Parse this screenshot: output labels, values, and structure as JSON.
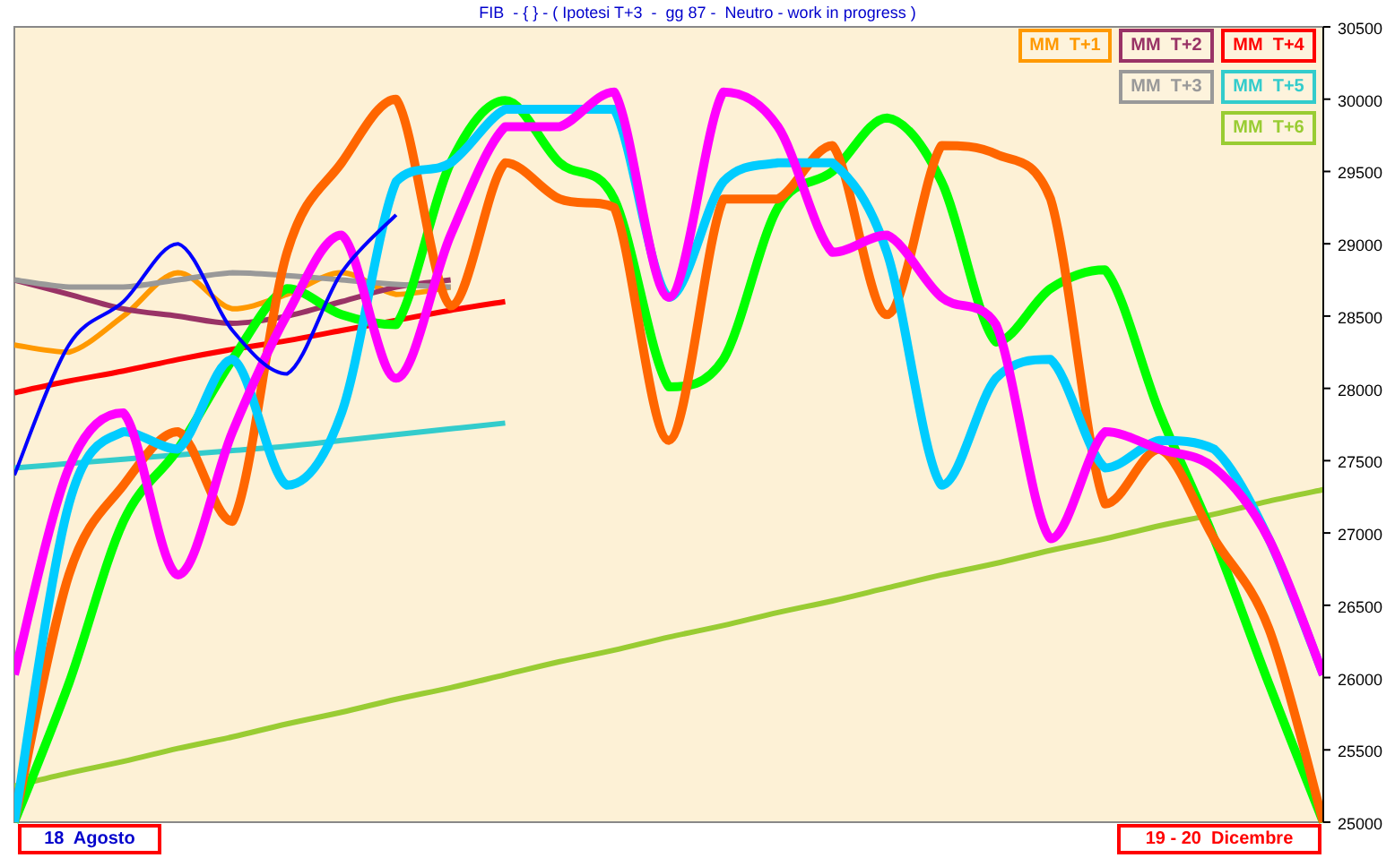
{
  "chart": {
    "title": "FIB  - { } - ( Ipotesi T+3  -  gg 87 -  Neutro - work in progress )",
    "start_label": "18  Agosto",
    "end_label": "19 - 20  Dicembre",
    "chart_data": {
      "type": "line",
      "ylim": [
        25000,
        30500
      ],
      "yticks": [
        25000,
        25500,
        26000,
        26500,
        27000,
        27500,
        28000,
        28500,
        29000,
        29500,
        30000,
        30500
      ],
      "series": [
        {
          "name": "MM  T+1",
          "color": "#ff9900",
          "values": [
            28300,
            28250,
            28500,
            28800,
            28550,
            28650,
            28800,
            28650,
            28700,
            null,
            null,
            null,
            null,
            null,
            null,
            null,
            null,
            null,
            null,
            null,
            null,
            null,
            null,
            null,
            null
          ]
        },
        {
          "name": "MM  T+2",
          "color": "#993366",
          "values": [
            28750,
            28650,
            28550,
            28500,
            28450,
            28500,
            28600,
            28700,
            28750,
            null,
            null,
            null,
            null,
            null,
            null,
            null,
            null,
            null,
            null,
            null,
            null,
            null,
            null,
            null,
            null
          ]
        },
        {
          "name": "MM  T+4",
          "color": "#ff0000",
          "values": [
            27970,
            28050,
            28120,
            28200,
            28270,
            28330,
            28400,
            28470,
            28540,
            28600,
            null,
            null,
            null,
            null,
            null,
            null,
            null,
            null,
            null,
            null,
            null,
            null,
            null,
            null,
            null
          ]
        },
        {
          "name": "MM  T+3",
          "color": "#999999",
          "values": [
            28750,
            28700,
            28700,
            28750,
            28800,
            28780,
            28750,
            28720,
            28700,
            null,
            null,
            null,
            null,
            null,
            null,
            null,
            null,
            null,
            null,
            null,
            null,
            null,
            null,
            null,
            null
          ]
        },
        {
          "name": "MM  T+5",
          "color": "#33cccc",
          "values": [
            27450,
            27480,
            27510,
            27540,
            27570,
            27600,
            27640,
            27680,
            27720,
            27760,
            null,
            null,
            null,
            null,
            null,
            null,
            null,
            null,
            null,
            null,
            null,
            null,
            null,
            null,
            null
          ]
        },
        {
          "name": "MM  T+6",
          "color": "#99cc33",
          "values": [
            25250,
            25340,
            25420,
            25510,
            25590,
            25680,
            25760,
            25850,
            25930,
            26020,
            26110,
            26190,
            26280,
            26360,
            26450,
            26530,
            26620,
            26710,
            26790,
            26880,
            26960,
            27050,
            27130,
            27220,
            27300
          ]
        },
        {
          "color": "#00ff00",
          "values": [
            25000,
            25960,
            27080,
            27580,
            28200,
            28690,
            28510,
            28440,
            29560,
            29990,
            29560,
            29310,
            28010,
            28200,
            29250,
            29500,
            29870,
            29430,
            28320,
            28690,
            28820,
            27830,
            26960,
            25960,
            25000
          ]
        },
        {
          "color": "#ff6600",
          "values": [
            25000,
            26710,
            27330,
            27700,
            27080,
            28940,
            29560,
            30000,
            28570,
            29560,
            29310,
            29250,
            27640,
            29310,
            29310,
            29680,
            28510,
            29680,
            29620,
            29310,
            27200,
            27580,
            26960,
            26340,
            25000
          ]
        },
        {
          "color": "#00ccff",
          "values": [
            25000,
            27200,
            27700,
            27580,
            28200,
            27330,
            27830,
            29430,
            29560,
            29930,
            29930,
            29930,
            28630,
            29430,
            29560,
            29560,
            28940,
            27330,
            28070,
            28200,
            27450,
            27640,
            27580,
            26960,
            26020
          ]
        },
        {
          "color": "#ff00ff",
          "values": [
            26020,
            27450,
            27830,
            26710,
            27700,
            28510,
            29060,
            28070,
            29060,
            29810,
            29810,
            30050,
            28630,
            30050,
            29810,
            28940,
            29060,
            28630,
            28440,
            26960,
            27700,
            27580,
            27450,
            26960,
            26020
          ]
        },
        {
          "color": "#0000ff",
          "values": [
            27400,
            28300,
            28600,
            29000,
            28400,
            28100,
            28800,
            29200,
            null,
            null,
            null,
            null,
            null,
            null,
            null,
            null,
            null,
            null,
            null,
            null,
            null,
            null,
            null,
            null,
            null
          ]
        }
      ]
    }
  }
}
